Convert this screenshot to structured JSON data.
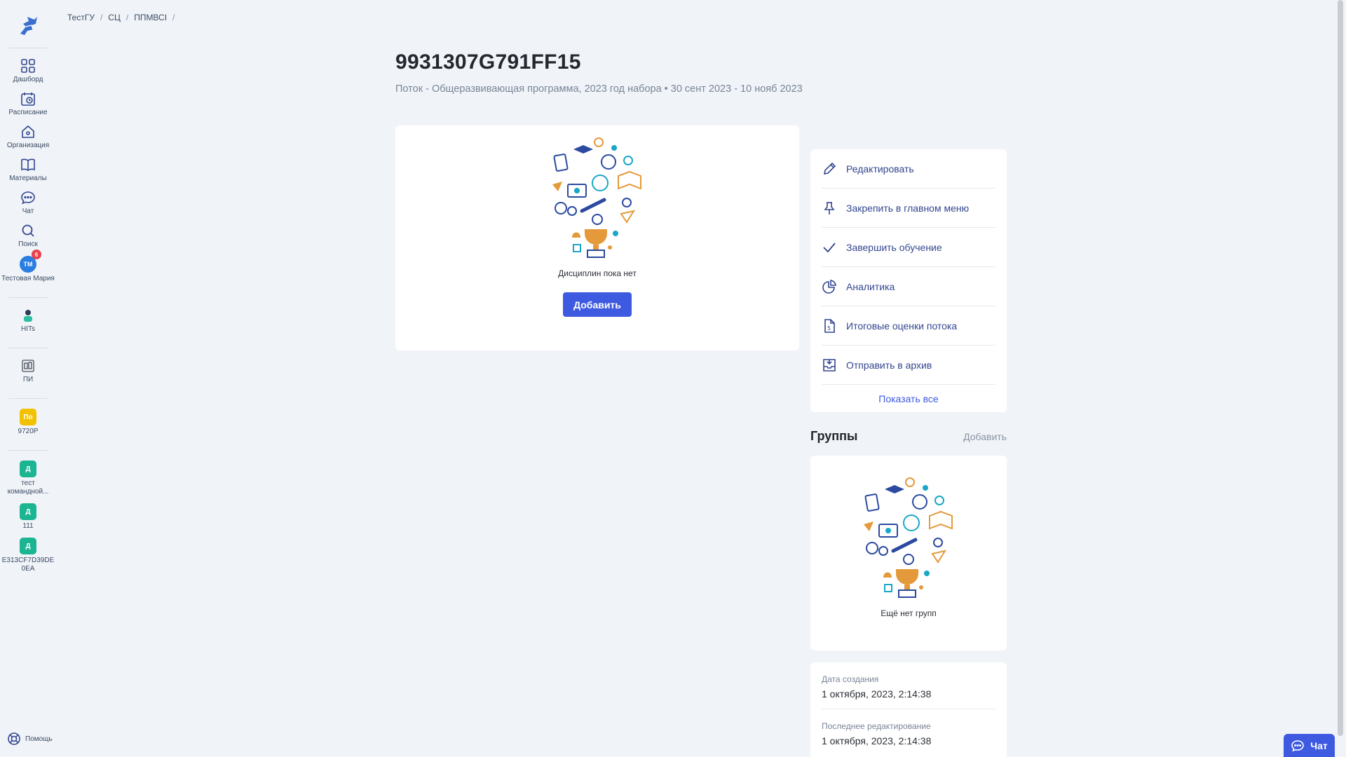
{
  "sidebar": {
    "items": [
      {
        "label": "Дашборд",
        "icon": "dashboard-icon"
      },
      {
        "label": "Расписание",
        "icon": "schedule-icon"
      },
      {
        "label": "Организация",
        "icon": "organization-icon"
      },
      {
        "label": "Материалы",
        "icon": "materials-icon"
      },
      {
        "label": "Чат",
        "icon": "chat-icon"
      },
      {
        "label": "Поиск",
        "icon": "search-icon"
      }
    ],
    "user": {
      "initials": "ТМ",
      "notifications": "6",
      "label": "Тестовая Мария"
    },
    "extra": [
      {
        "label": "HITs"
      },
      {
        "label": "ПИ"
      }
    ],
    "orgs": [
      {
        "initial": "По",
        "label": "9720P",
        "color": "#f2c200"
      },
      {
        "initial": "Д",
        "label": "тест командной...",
        "color": "#1bb592"
      },
      {
        "initial": "Д",
        "label": "111",
        "color": "#1bb592"
      },
      {
        "initial": "Д",
        "label": "E313CF7D39DE0EA",
        "color": "#1bb592"
      }
    ],
    "help_label": "Помощь"
  },
  "breadcrumb": [
    "ТестГУ",
    "СЦ",
    "ППМВСI"
  ],
  "page": {
    "title": "9931307G791FF15",
    "subtitle": "Поток - Общеразвивающая программа, 2023 год набора • 30 сент 2023 - 10 нояб 2023"
  },
  "disciplines": {
    "empty_text": "Дисциплин пока нет",
    "add_label": "Добавить"
  },
  "actions": {
    "items": [
      {
        "label": "Редактировать"
      },
      {
        "label": "Закрепить в главном меню"
      },
      {
        "label": "Завершить обучение"
      },
      {
        "label": "Аналитика"
      },
      {
        "label": "Итоговые оценки потока"
      },
      {
        "label": "Отправить в архив"
      }
    ],
    "show_all": "Показать все"
  },
  "groups": {
    "title": "Группы",
    "add_label": "Добавить",
    "empty_text": "Ещё нет групп"
  },
  "meta": {
    "created_label": "Дата создания",
    "created_value": "1 октября, 2023, 2:14:38",
    "edited_label": "Последнее редактирование",
    "edited_value": "1 октября, 2023, 2:14:38"
  },
  "chat_fab": {
    "label": "Чат"
  },
  "colors": {
    "accent": "#3e5ae0",
    "nav_icon": "#33468f",
    "background": "#f0f4f8"
  }
}
